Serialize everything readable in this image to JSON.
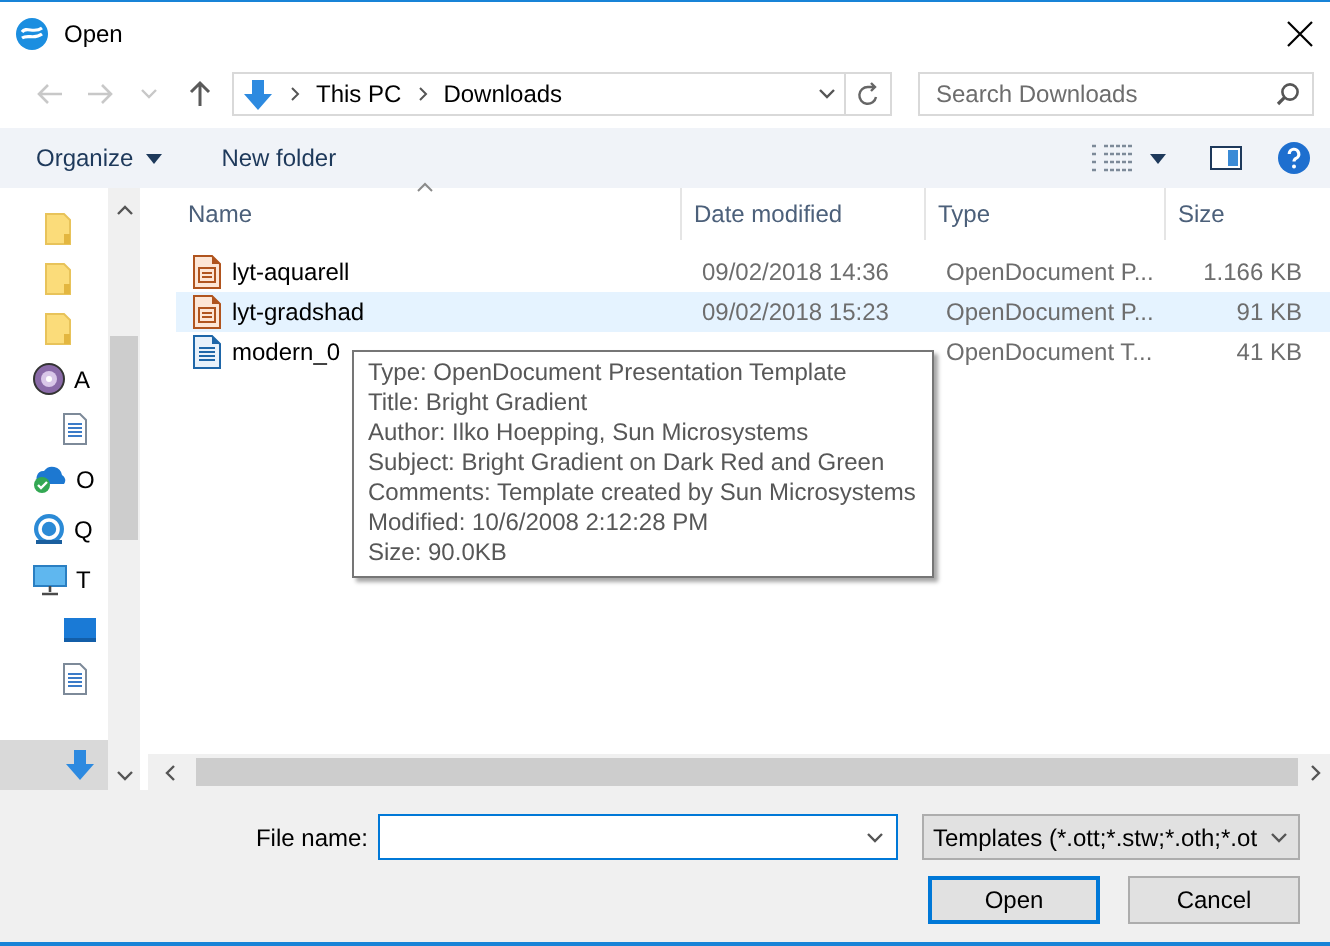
{
  "window": {
    "title": "Open"
  },
  "nav": {
    "buttons": [
      {
        "kind": "back",
        "disabled": true
      },
      {
        "kind": "forward",
        "disabled": true
      },
      {
        "kind": "recent",
        "disabled": true
      },
      {
        "kind": "up",
        "disabled": false
      }
    ],
    "path": [
      "This PC",
      "Downloads"
    ],
    "search": {
      "placeholder": "Search Downloads"
    }
  },
  "toolbar": {
    "organize": "Organize",
    "new_folder": "New folder"
  },
  "sidebar": {
    "items": [
      {
        "kind": "folder",
        "selected": false
      },
      {
        "kind": "folder",
        "selected": false
      },
      {
        "kind": "folder",
        "selected": false
      },
      {
        "kind": "disc",
        "label": "A",
        "selected": false
      },
      {
        "kind": "document",
        "selected": false
      },
      {
        "kind": "cloud",
        "label": "O",
        "selected": false
      },
      {
        "kind": "sync",
        "label": "Q",
        "selected": false
      },
      {
        "kind": "computer",
        "label": "T",
        "selected": false
      },
      {
        "kind": "desktop",
        "selected": false
      },
      {
        "kind": "document",
        "selected": false
      },
      {
        "kind": "download",
        "selected": true
      }
    ]
  },
  "file_list": {
    "columns": [
      {
        "label": "Name",
        "sorted": true
      },
      {
        "label": "Date modified",
        "sorted": false
      },
      {
        "label": "Type",
        "sorted": false
      },
      {
        "label": "Size",
        "sorted": false
      }
    ],
    "rows": [
      {
        "kind": "presentation",
        "name": "lyt-aquarell",
        "date": "09/02/2018 14:36",
        "type": "OpenDocument P...",
        "size": "1.166 KB",
        "selected": false
      },
      {
        "kind": "presentation",
        "name": "lyt-gradshad",
        "date": "09/02/2018 15:23",
        "type": "OpenDocument P...",
        "size": "91 KB",
        "selected": true
      },
      {
        "kind": "text",
        "name": "modern_0",
        "type": "OpenDocument T...",
        "size": "41 KB",
        "selected": false
      }
    ]
  },
  "tooltip": {
    "lines": [
      "Type: OpenDocument Presentation Template",
      "Title: Bright Gradient",
      "Author: Ilko Hoepping, Sun Microsystems",
      "Subject: Bright Gradient on Dark Red and Green",
      "Comments: Template created by Sun Microsystems",
      "Modified: 10/6/2008 2:12:28 PM",
      "Size: 90.0KB"
    ]
  },
  "footer": {
    "file_name_label": "File name:",
    "file_type": "Templates (*.ott;*.stw;*.oth;*.ot",
    "buttons": [
      {
        "label": "Open",
        "default": true
      },
      {
        "label": "Cancel",
        "default": false
      }
    ]
  }
}
